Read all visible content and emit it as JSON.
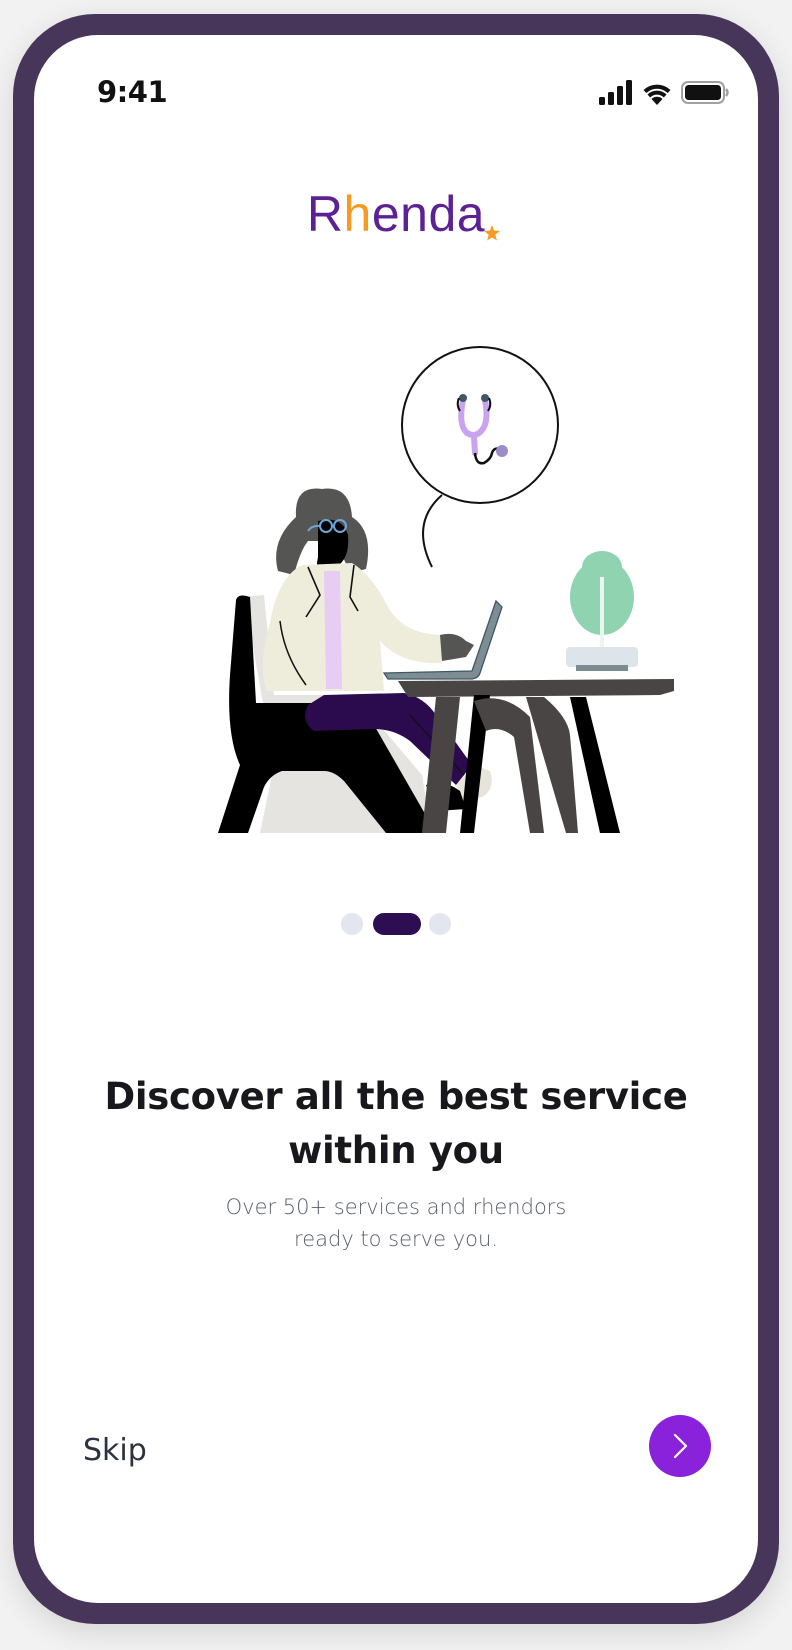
{
  "status_bar": {
    "time": "9:41",
    "icons": [
      "signal-icon",
      "wifi-icon",
      "battery-icon"
    ]
  },
  "brand": {
    "logo_text_start": "R",
    "logo_text_highlight": "h",
    "logo_text_end": "enda",
    "logo_color": "#5c2295",
    "logo_accent_color": "#f59a23"
  },
  "illustration": {
    "subject": "doctor-at-desk-with-laptop",
    "thought_bubble_icon": "stethoscope-icon"
  },
  "onboarding": {
    "page_indicator": {
      "total_pages": 3,
      "active_page": 2
    },
    "headline": "Discover all the best service within you",
    "subtitle": "Over 50+ services and rhendors ready to serve you."
  },
  "actions": {
    "skip_label": "Skip",
    "next_icon": "chevron-right-icon",
    "next_button_color": "#8a21db"
  },
  "colors": {
    "frame": "#473659",
    "indicator_active": "#2e0e52",
    "indicator_inactive": "#e4e6ef"
  }
}
